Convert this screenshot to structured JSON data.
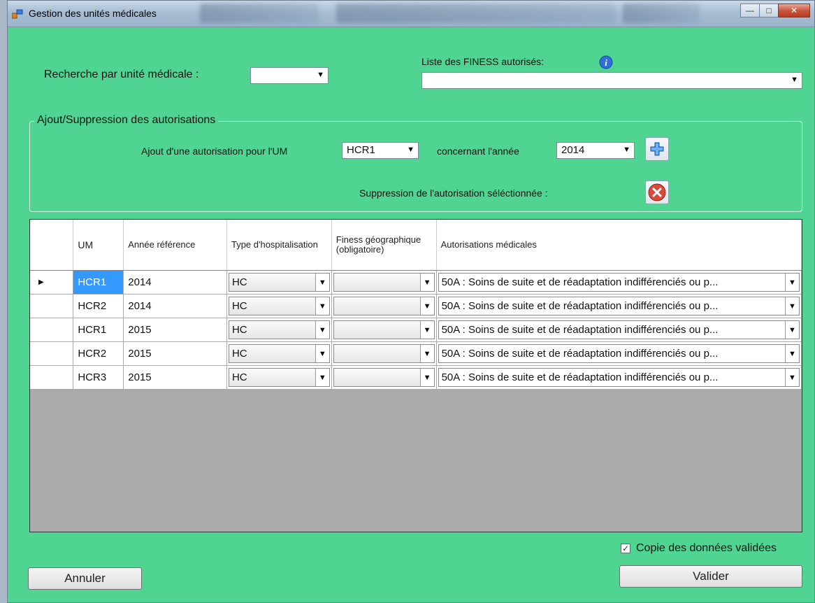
{
  "window": {
    "title": "Gestion des unités médicales",
    "controls": [
      "minimize-icon",
      "maximize-icon",
      "close-icon"
    ]
  },
  "search": {
    "label": "Recherche par unité médicale :",
    "value": ""
  },
  "finess": {
    "label": "Liste des FINESS autorisés:",
    "value": ""
  },
  "group": {
    "title": "Ajout/Suppression des autorisations",
    "add_label": "Ajout d'une autorisation pour l'UM",
    "um_value": "HCR1",
    "year_label": "concernant l'année",
    "year_value": "2014",
    "delete_label": "Suppression de l'autorisation séléctionnée :"
  },
  "grid": {
    "columns": [
      "UM",
      "Année référence",
      "Type d'hospitalisation",
      "Finess géographique (obligatoire)",
      "Autorisations médicales"
    ],
    "rows": [
      {
        "um": "HCR1",
        "annee": "2014",
        "type": "HC",
        "finess": "",
        "autorisation": "50A : Soins de suite et de réadaptation indifférenciés ou p...",
        "selected": true
      },
      {
        "um": "HCR2",
        "annee": "2014",
        "type": "HC",
        "finess": "",
        "autorisation": "50A : Soins de suite et de réadaptation indifférenciés ou p...",
        "selected": false
      },
      {
        "um": "HCR1",
        "annee": "2015",
        "type": "HC",
        "finess": "",
        "autorisation": "50A : Soins de suite et de réadaptation indifférenciés ou p...",
        "selected": false
      },
      {
        "um": "HCR2",
        "annee": "2015",
        "type": "HC",
        "finess": "",
        "autorisation": "50A : Soins de suite et de réadaptation indifférenciés ou p...",
        "selected": false
      },
      {
        "um": "HCR3",
        "annee": "2015",
        "type": "HC",
        "finess": "",
        "autorisation": "50A : Soins de suite et de réadaptation indifférenciés ou p...",
        "selected": false
      }
    ]
  },
  "copy_checkbox": {
    "label": "Copie des données validées",
    "checked": true
  },
  "buttons": {
    "cancel": "Annuler",
    "validate": "Valider"
  },
  "colors": {
    "background": "#4fd591",
    "selection": "#3399ff",
    "grid_empty": "#ababab"
  }
}
